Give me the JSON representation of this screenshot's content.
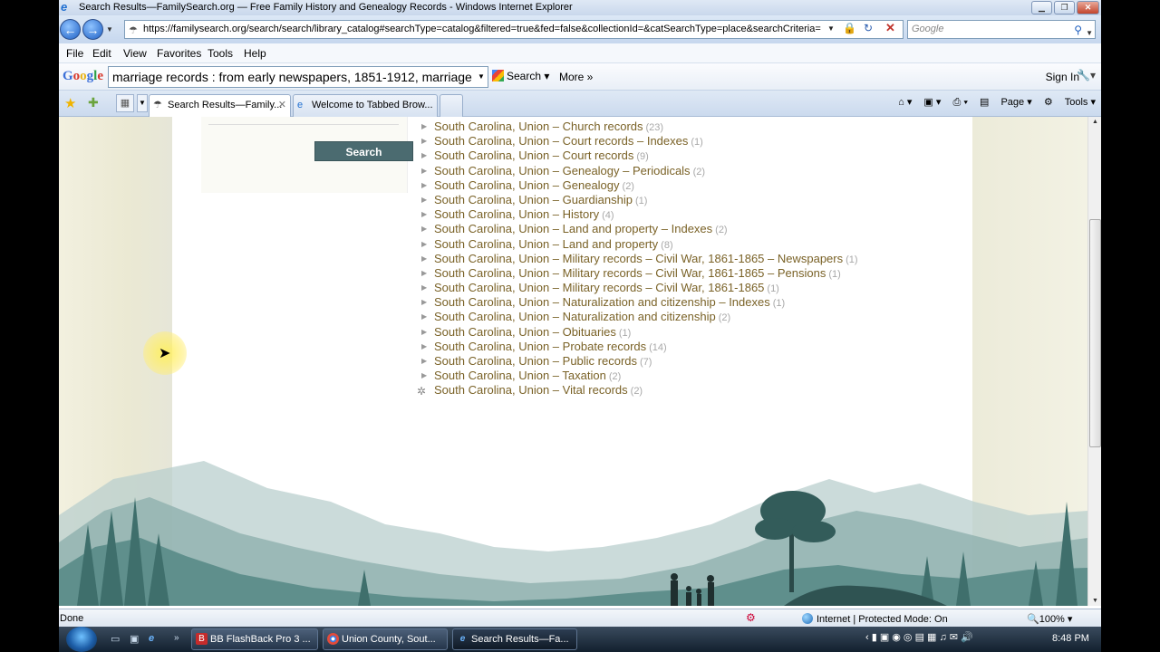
{
  "window": {
    "title": "Search Results—FamilySearch.org — Free Family History and Genealogy Records - Windows Internet Explorer"
  },
  "address_bar": {
    "url": "https://familysearch.org/search/search/library_catalog#searchType=catalog&filtered=true&fed=false&collectionId=&catSearchType=place&searchCriteria=",
    "search_placeholder": "Google"
  },
  "menu": [
    "File",
    "Edit",
    "View",
    "Favorites",
    "Tools",
    "Help"
  ],
  "google_toolbar": {
    "logo": "Google",
    "query": "marriage records : from early newspapers, 1851-1912, marriage",
    "search_label": "Search",
    "more_label": "More »",
    "sign_in_label": "Sign In"
  },
  "tabs": [
    {
      "label": "Search Results—Family...",
      "active": true
    },
    {
      "label": "Welcome to Tabbed Brow...",
      "active": false
    }
  ],
  "command_bar": {
    "page_label": "Page",
    "tools_label": "Tools"
  },
  "sidebar": {
    "search_button": "Search"
  },
  "results": [
    {
      "label": "South Carolina, Union – Church records",
      "count": "(23)"
    },
    {
      "label": "South Carolina, Union – Court records – Indexes",
      "count": "(1)"
    },
    {
      "label": "South Carolina, Union – Court records",
      "count": "(9)"
    },
    {
      "label": "South Carolina, Union – Genealogy – Periodicals",
      "count": "(2)"
    },
    {
      "label": "South Carolina, Union – Genealogy",
      "count": "(2)"
    },
    {
      "label": "South Carolina, Union – Guardianship",
      "count": "(1)"
    },
    {
      "label": "South Carolina, Union – History",
      "count": "(4)"
    },
    {
      "label": "South Carolina, Union – Land and property – Indexes",
      "count": "(2)"
    },
    {
      "label": "South Carolina, Union – Land and property",
      "count": "(8)"
    },
    {
      "label": "South Carolina, Union – Military records – Civil War, 1861-1865 – Newspapers",
      "count": "(1)"
    },
    {
      "label": "South Carolina, Union – Military records – Civil War, 1861-1865 – Pensions",
      "count": "(1)"
    },
    {
      "label": "South Carolina, Union – Military records – Civil War, 1861-1865",
      "count": "(1)"
    },
    {
      "label": "South Carolina, Union – Naturalization and citizenship – Indexes",
      "count": "(1)"
    },
    {
      "label": "South Carolina, Union – Naturalization and citizenship",
      "count": "(2)"
    },
    {
      "label": "South Carolina, Union – Obituaries",
      "count": "(1)"
    },
    {
      "label": "South Carolina, Union – Probate records",
      "count": "(14)"
    },
    {
      "label": "South Carolina, Union – Public records",
      "count": "(7)"
    },
    {
      "label": "South Carolina, Union – Taxation",
      "count": "(2)"
    },
    {
      "label": "South Carolina, Union – Vital records",
      "count": "(2)",
      "loading": true
    }
  ],
  "status_bar": {
    "status": "Done",
    "zone": "Internet | Protected Mode: On",
    "zoom": "100%"
  },
  "taskbar": {
    "tasks": [
      {
        "label": "BB FlashBack Pro 3 ...",
        "active": false
      },
      {
        "label": "Union County, Sout...",
        "active": false
      },
      {
        "label": "Search Results—Fa...",
        "active": true
      }
    ],
    "clock": "8:48 PM"
  },
  "colors": {
    "result_link": "#7a6227",
    "search_button": "#4b6b70",
    "landscape": "#4e7c7a"
  }
}
